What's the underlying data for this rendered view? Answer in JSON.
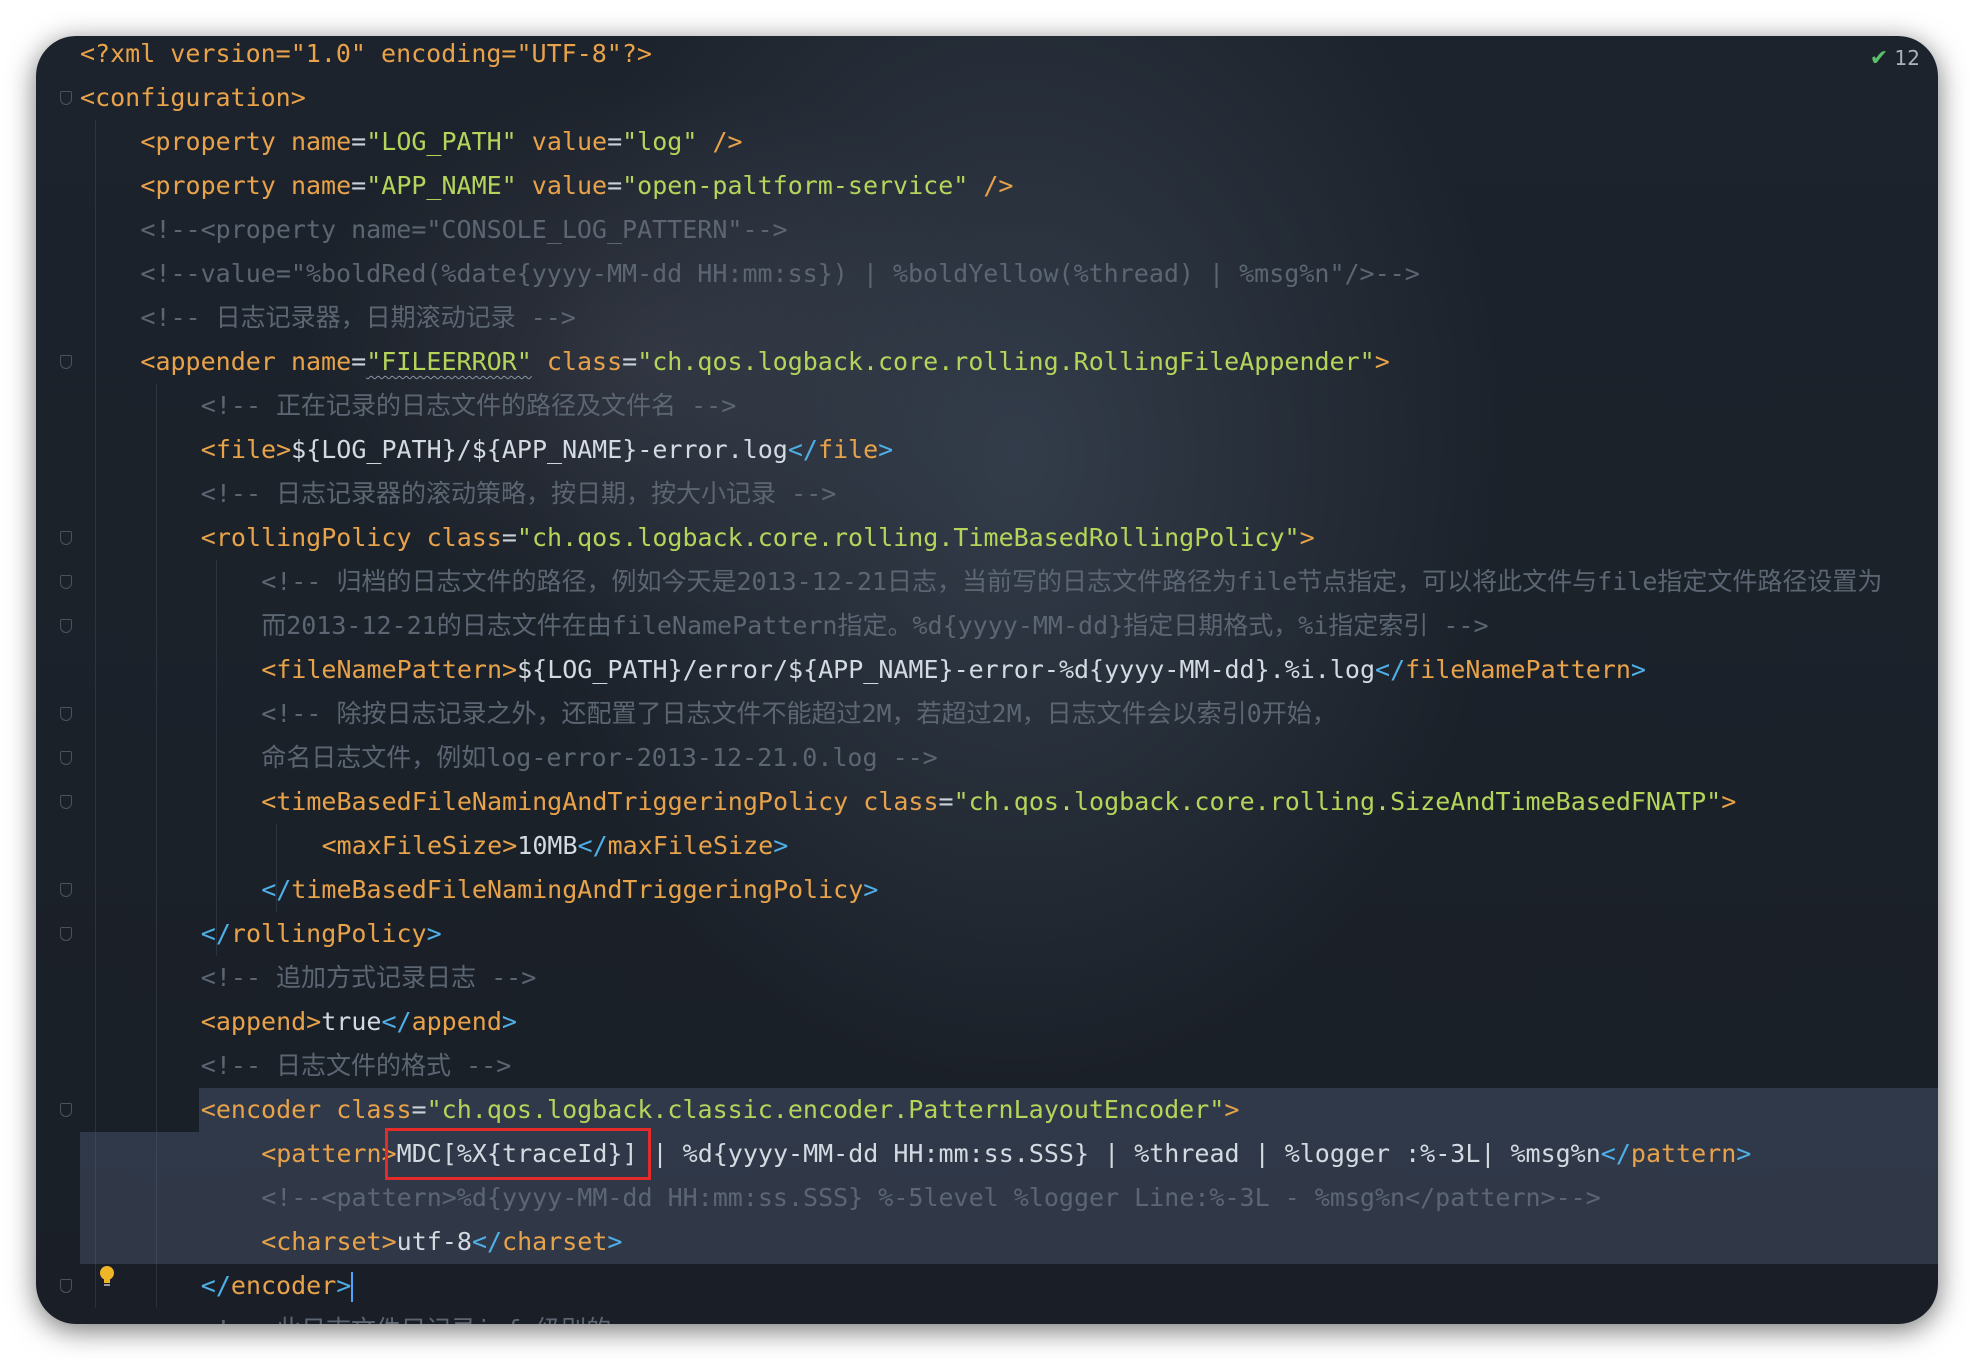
{
  "status": {
    "check_count": "12",
    "check_icon": "check-icon"
  },
  "colors": {
    "tag": "#e8a24a",
    "close_tag": "#4fb0e8",
    "string": "#b5d55a",
    "comment": "#5c6673",
    "text": "#d4dae2",
    "highlight_box": "#e52a2a"
  },
  "lines": [
    {
      "pre": "<?xml version=\"1.0\" encoding=\"UTF-8\"?>"
    },
    {
      "tag": "configuration"
    },
    {
      "tag": "property",
      "a1": "name",
      "v1": "\"LOG_PATH\"",
      "a2": "value",
      "v2": "\"log\"",
      "end": " />"
    },
    {
      "tag": "property",
      "a1": "name",
      "v1": "\"APP_NAME\"",
      "a2": "value",
      "v2": "\"open-paltform-service\"",
      "end": " />"
    },
    {
      "comment": "<!--<property name=\"CONSOLE_LOG_PATTERN\"-->"
    },
    {
      "comment": "<!--value=\"%boldRed(%date{yyyy-MM-dd HH:mm:ss}) | %boldYellow(%thread) | %msg%n\"/>-->"
    },
    {
      "comment": "<!-- 日志记录器，日期滚动记录 -->"
    },
    {
      "tag": "appender",
      "a1": "name",
      "v1": "\"FILEERROR\"",
      "a2": "class",
      "v2": "\"ch.qos.logback.core.rolling.RollingFileAppender\"",
      "end": ">"
    },
    {
      "comment": "<!-- 正在记录的日志文件的路径及文件名 -->"
    },
    {
      "tag": "file",
      "text": "${LOG_PATH}/${APP_NAME}-error.log"
    },
    {
      "comment": "<!-- 日志记录器的滚动策略，按日期，按大小记录 -->"
    },
    {
      "tag": "rollingPolicy",
      "a1": "class",
      "v1": "\"ch.qos.logback.core.rolling.TimeBasedRollingPolicy\"",
      "end": ">"
    },
    {
      "comment": "<!-- 归档的日志文件的路径，例如今天是2013-12-21日志，当前写的日志文件路径为file节点指定，可以将此文件与file指定文件路径设置为"
    },
    {
      "comment": "而2013-12-21的日志文件在由fileNamePattern指定。%d{yyyy-MM-dd}指定日期格式，%i指定索引 -->"
    },
    {
      "tag": "fileNamePattern",
      "text": "${LOG_PATH}/error/${APP_NAME}-error-%d{yyyy-MM-dd}.%i.log"
    },
    {
      "comment": "<!-- 除按日志记录之外，还配置了日志文件不能超过2M，若超过2M，日志文件会以索引0开始，"
    },
    {
      "comment": "命名日志文件，例如log-error-2013-12-21.0.log -->"
    },
    {
      "tag": "timeBasedFileNamingAndTriggeringPolicy",
      "a1": "class",
      "v1": "\"ch.qos.logback.core.rolling.SizeAndTimeBasedFNATP\"",
      "end": ">"
    },
    {
      "tag": "maxFileSize",
      "text": "10MB"
    },
    {
      "close": "timeBasedFileNamingAndTriggeringPolicy"
    },
    {
      "close": "rollingPolicy"
    },
    {
      "comment": "<!-- 追加方式记录日志 -->"
    },
    {
      "tag": "append",
      "text": "true"
    },
    {
      "comment": "<!-- 日志文件的格式 -->"
    },
    {
      "tag": "encoder",
      "a1": "class",
      "v1": "\"ch.qos.logback.classic.encoder.PatternLayoutEncoder\"",
      "end": ">"
    },
    {
      "tag": "pattern",
      "boxed": "MDC[%X{traceId}]",
      "text": " | %d{yyyy-MM-dd HH:mm:ss.SSS} | %thread | %logger :%-3L| %msg%n"
    },
    {
      "comment": "<!--<pattern>%d{yyyy-MM-dd HH:mm:ss.SSS} %-5level %logger Line:%-3L - %msg%n</pattern>-->"
    },
    {
      "tag": "charset",
      "text": "utf-8"
    },
    {
      "close": "encoder"
    },
    {
      "comment": "<!-- 此日志文件只记录info级别的 -->"
    }
  ]
}
